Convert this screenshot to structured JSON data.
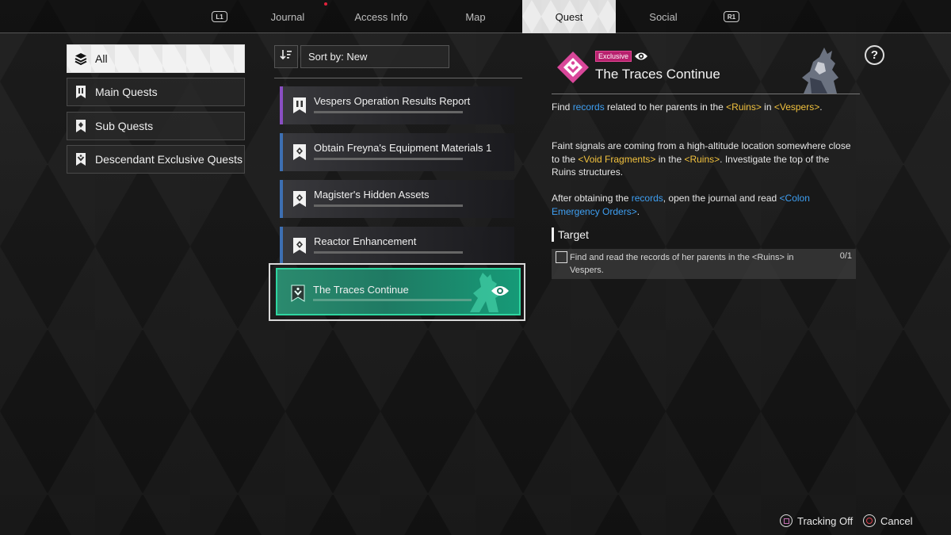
{
  "nav": {
    "left_shoulder": "L1",
    "right_shoulder": "R1",
    "tabs": [
      {
        "label": "Journal"
      },
      {
        "label": "Access Info"
      },
      {
        "label": "Map"
      },
      {
        "label": "Quest",
        "active": true
      },
      {
        "label": "Social"
      }
    ]
  },
  "categories": [
    {
      "label": "All",
      "icon": "layers-icon",
      "active": true
    },
    {
      "label": "Main Quests",
      "icon": "main-quest-icon"
    },
    {
      "label": "Sub Quests",
      "icon": "sub-quest-icon"
    },
    {
      "label": "Descendant Exclusive Quests",
      "icon": "exclusive-quest-icon"
    }
  ],
  "sort": {
    "icon": "sort-descending-icon",
    "label": "Sort by: New"
  },
  "quests": [
    {
      "title": "Vespers Operation Results Report",
      "type": "main",
      "accent": "#8a4fc4"
    },
    {
      "title": "Obtain Freyna's Equipment Materials 1",
      "type": "sub",
      "accent": "#3d6fb3"
    },
    {
      "title": "Magister's Hidden Assets",
      "type": "sub",
      "accent": "#3d6fb3"
    },
    {
      "title": "Reactor Enhancement",
      "type": "sub",
      "accent": "#3d6fb3"
    },
    {
      "title": "The Traces Continue",
      "type": "exclusive",
      "accent": "#2ed6a0",
      "selected": true,
      "tracked_icon": "eye-icon"
    }
  ],
  "detail": {
    "badge": "Exclusive",
    "badge_color": "#b8216e",
    "title": "The Traces Continue",
    "help": "?",
    "description": [
      [
        {
          "t": "Find "
        },
        {
          "t": "records",
          "c": "blue"
        },
        {
          "t": " related to her parents in the "
        },
        {
          "t": "<Ruins>",
          "c": "yellow"
        },
        {
          "t": " in "
        },
        {
          "t": "<Vespers>",
          "c": "yellow"
        },
        {
          "t": "."
        }
      ],
      [
        {
          "t": "Faint signals are coming from a high-altitude location somewhere close to the "
        },
        {
          "t": "<Void Fragments>",
          "c": "yellow"
        },
        {
          "t": " in the "
        },
        {
          "t": "<Ruins>",
          "c": "yellow"
        },
        {
          "t": ". Investigate the top of the Ruins structures."
        }
      ],
      [
        {
          "t": "After obtaining the "
        },
        {
          "t": "records",
          "c": "blue"
        },
        {
          "t": ", open the journal and read "
        },
        {
          "t": "<Colon Emergency Orders>",
          "c": "blue"
        },
        {
          "t": "."
        }
      ]
    ],
    "target_label": "Target",
    "objectives": [
      {
        "text": "Find and read the records of her parents in the <Ruins> in Vespers.",
        "progress": "0/1",
        "done": false
      }
    ]
  },
  "footer": [
    {
      "label": "Tracking Off",
      "button": "square-button-icon"
    },
    {
      "label": "Cancel",
      "button": "circle-button-icon"
    }
  ],
  "colors": {
    "highlight_blue": "#3e9ff2",
    "highlight_yellow": "#f2c23e",
    "selected_quest": "#1f7a63",
    "main_quest_accent": "#8a4fc4",
    "sub_quest_accent": "#3d6fb3"
  }
}
